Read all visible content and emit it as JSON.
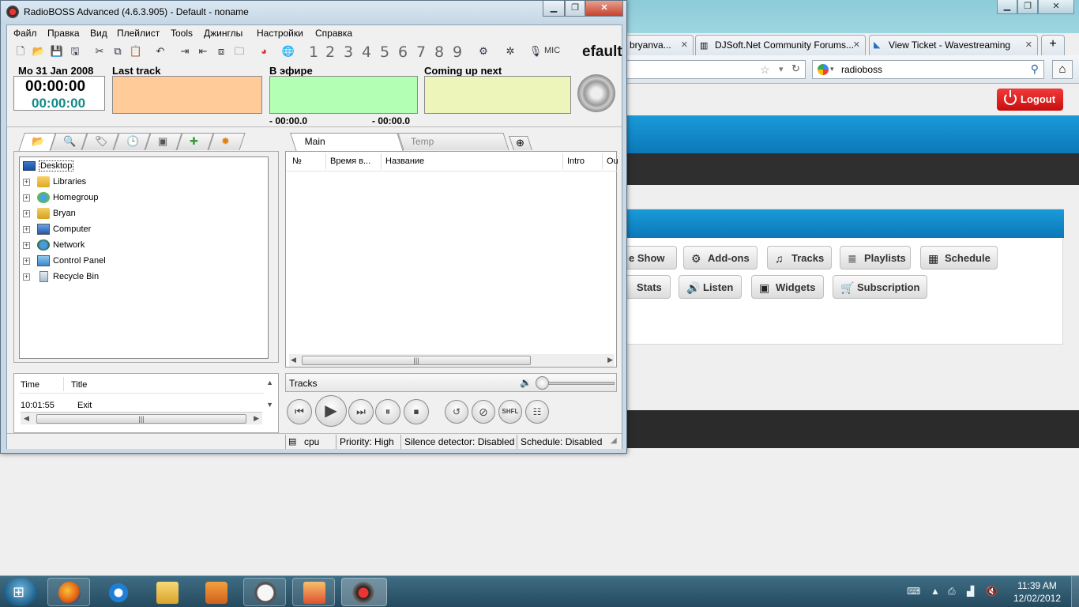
{
  "browser": {
    "controls": {
      "minimize": "▁",
      "maximize": "❐",
      "close": "✕"
    },
    "tabs": [
      {
        "label": "bryanva..."
      },
      {
        "label": "DJSoft.Net Community Forums..."
      },
      {
        "label": "View Ticket - Wavestreaming"
      }
    ],
    "new_tab": "+",
    "search_value": "radioboss",
    "page": {
      "logout": "Logout",
      "buttons_row1": [
        {
          "label": "e Show",
          "icon": "✺"
        },
        {
          "label": "Add-ons",
          "icon": "⚙"
        },
        {
          "label": "Tracks",
          "icon": "♫"
        },
        {
          "label": "Playlists",
          "icon": "≣"
        },
        {
          "label": "Schedule",
          "icon": "▦"
        }
      ],
      "buttons_row2": [
        {
          "label": "Stats",
          "icon": ""
        },
        {
          "label": "Listen",
          "icon": "🔊"
        },
        {
          "label": "Widgets",
          "icon": "▣"
        },
        {
          "label": "Subscription",
          "icon": "🛒"
        }
      ]
    }
  },
  "radioboss": {
    "title": "RadioBOSS Advanced (4.6.3.905) - Default - noname",
    "menu": [
      "Файл",
      "Правка",
      "Вид",
      "Плейлист",
      "Tools",
      "Джинглы",
      "Настройки",
      "Справка"
    ],
    "toolbar": {
      "numbers": [
        "1",
        "2",
        "3",
        "4",
        "5",
        "6",
        "7",
        "8",
        "9"
      ],
      "mic": "MIC",
      "profile_fragment": "efault"
    },
    "info": {
      "date": "Mo 31 Jan 2008",
      "clock_main": "00:00:00",
      "clock_sub": "00:00:00",
      "last_track_label": "Last track",
      "on_air_label": "В эфире",
      "next_label": "Coming up next",
      "on_air_elapsed": "- 00:00.0",
      "on_air_remaining": "- 00:00.0"
    },
    "tree": [
      {
        "label": "Desktop"
      },
      {
        "label": "Libraries"
      },
      {
        "label": "Homegroup"
      },
      {
        "label": "Bryan"
      },
      {
        "label": "Computer"
      },
      {
        "label": "Network"
      },
      {
        "label": "Control Panel"
      },
      {
        "label": "Recycle Bin"
      }
    ],
    "history": {
      "columns": [
        "Time",
        "Title"
      ],
      "rows": [
        {
          "time": "10:01:55",
          "title": "Exit"
        }
      ]
    },
    "playlist_tabs": [
      "Main",
      "Temp"
    ],
    "playlist_columns": [
      "№",
      "Время в...",
      "Название",
      "Intro",
      "Ou"
    ],
    "tracks_label": "Tracks",
    "player": {
      "shfl": "SHFL"
    },
    "status": {
      "cpu": "cpu",
      "priority": "Priority: High",
      "silence": "Silence detector: Disabled",
      "schedule": "Schedule: Disabled"
    },
    "colors": {
      "last_track": "#ffcc99",
      "on_air": "#b3ffb3",
      "next": "#eef5bb"
    }
  },
  "taskbar": {
    "time": "11:39 AM",
    "date": "12/02/2012"
  }
}
